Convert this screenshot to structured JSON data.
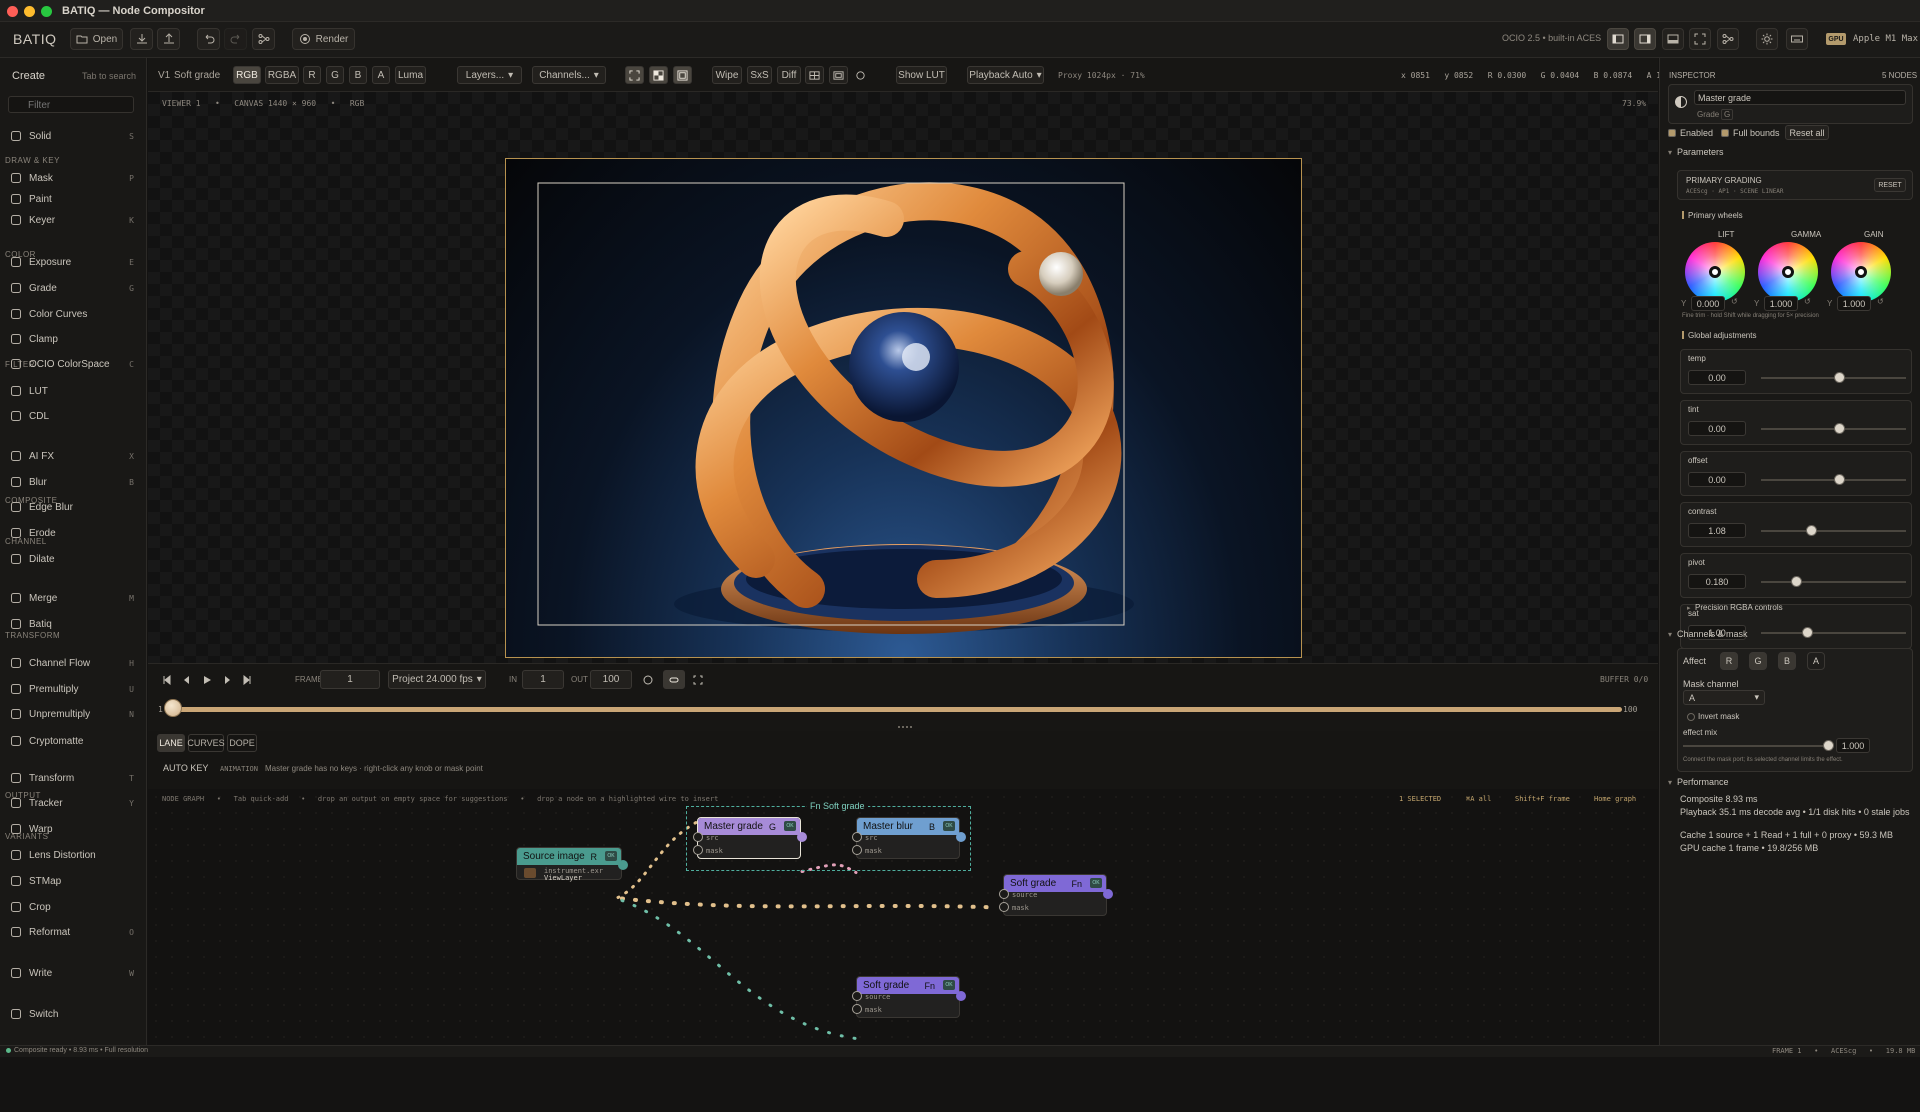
{
  "window": {
    "title": "BATIQ — Node Compositor"
  },
  "toolbar": {
    "logo": "BATIQ",
    "open": "Open",
    "render": "Render",
    "ocio": "OCIO 2.5 • built-in ACES",
    "gpu_badge": "GPU",
    "gpu_name": "Apple M1 Max"
  },
  "left": {
    "title": "Create",
    "hint": "Tab to search",
    "filter_placeholder": "Filter",
    "sections": {
      "draw": "DRAW & KEY",
      "color": "COLOR",
      "filter": "FILTER",
      "composite": "COMPOSITE",
      "channel": "CHANNEL",
      "transform": "TRANSFORM",
      "output": "OUTPUT",
      "variants": "VARIANTS"
    },
    "items": [
      {
        "label": "Solid",
        "key": "S",
        "icon": "solid-icon"
      },
      {
        "label": "Mask",
        "key": "P",
        "icon": "mask-icon"
      },
      {
        "label": "Paint",
        "key": "",
        "icon": "brush-icon"
      },
      {
        "label": "Keyer",
        "key": "K",
        "icon": "keyer-icon"
      },
      {
        "label": "Exposure",
        "key": "E",
        "icon": "exposure-icon"
      },
      {
        "label": "Grade",
        "key": "G",
        "icon": "grade-icon"
      },
      {
        "label": "Color Curves",
        "key": "",
        "icon": "curves-icon"
      },
      {
        "label": "Clamp",
        "key": "",
        "icon": "clamp-icon"
      },
      {
        "label": "OCIO ColorSpace",
        "key": "C",
        "icon": "colorspace-icon"
      },
      {
        "label": "LUT",
        "key": "",
        "icon": "lut-icon"
      },
      {
        "label": "CDL",
        "key": "",
        "icon": "cdl-icon"
      },
      {
        "label": "AI FX",
        "key": "X",
        "icon": "sparkle-icon"
      },
      {
        "label": "Blur",
        "key": "B",
        "icon": "blur-icon"
      },
      {
        "label": "Edge Blur",
        "key": "",
        "icon": "edge-blur-icon"
      },
      {
        "label": "Erode",
        "key": "",
        "icon": "erode-icon"
      },
      {
        "label": "Dilate",
        "key": "",
        "icon": "dilate-icon"
      },
      {
        "label": "Merge",
        "key": "M",
        "icon": "merge-icon"
      },
      {
        "label": "Batiq",
        "key": "",
        "icon": "batiq-icon"
      },
      {
        "label": "Channel Flow",
        "key": "H",
        "icon": "channel-flow-icon"
      },
      {
        "label": "Premultiply",
        "key": "U",
        "icon": "premultiply-icon"
      },
      {
        "label": "Unpremultiply",
        "key": "N",
        "icon": "unpremultiply-icon"
      },
      {
        "label": "Cryptomatte",
        "key": "",
        "icon": "cryptomatte-icon"
      },
      {
        "label": "Transform",
        "key": "T",
        "icon": "transform-icon"
      },
      {
        "label": "Tracker",
        "key": "Y",
        "icon": "tracker-icon"
      },
      {
        "label": "Warp",
        "key": "",
        "icon": "warp-icon"
      },
      {
        "label": "Lens Distortion",
        "key": "",
        "icon": "lens-icon"
      },
      {
        "label": "STMap",
        "key": "",
        "icon": "stmap-icon"
      },
      {
        "label": "Crop",
        "key": "",
        "icon": "crop-icon"
      },
      {
        "label": "Reformat",
        "key": "O",
        "icon": "reformat-icon"
      },
      {
        "label": "Write",
        "key": "W",
        "icon": "write-icon"
      },
      {
        "label": "Switch",
        "key": "",
        "icon": "switch-icon"
      }
    ]
  },
  "viewer": {
    "slot": "V1",
    "node": "Soft grade",
    "channels": [
      "RGB",
      "RGBA",
      "R",
      "G",
      "B",
      "A",
      "Luma"
    ],
    "layers": "Layers...",
    "channels_dd": "Channels...",
    "wipe": "Wipe",
    "sxs": "SxS",
    "diff": "Diff",
    "show_lut": "Show LUT",
    "playback": "Playback Auto",
    "proxy": "Proxy 1024px · 71%",
    "pixel_readout": "x 0851   y 0852   R 0.0300   G 0.0404   B 0.0874   A 1.0000",
    "info": "VIEWER 1   •   CANVAS 1440 × 960   •   RGB",
    "zoom": "73.9%"
  },
  "transport": {
    "frame_label": "FRAME",
    "frame": "1",
    "fps": "Project 24.000 fps",
    "in_label": "IN",
    "in": "1",
    "out_label": "OUT",
    "out": "100",
    "buffer": "BUFFER 0/0",
    "start": "1",
    "end": "100"
  },
  "timeline": {
    "tabs": [
      "LANE",
      "CURVES",
      "DOPE"
    ],
    "autokey": "AUTO KEY",
    "animation_label": "ANIMATION",
    "animation_msg": "Master grade has no keys · right-click any knob or mask point"
  },
  "graph": {
    "hint": "NODE GRAPH   •   Tab quick-add   •   drop an output on empty space for suggestions   •   drop a node on a highlighted wire to insert",
    "selected": "1 SELECTED",
    "all": "⌘A all",
    "frame": "Shift+F frame",
    "home": "Home graph",
    "group_label": "Fn Soft grade",
    "nodes": {
      "source": {
        "title": "Source image",
        "key": "R",
        "file": "instrument.exr",
        "layer": "ViewLayer",
        "color": "#4a9b8e"
      },
      "master_grade": {
        "title": "Master grade",
        "key": "G",
        "p1": "src",
        "p2": "mask",
        "color": "#a78bd8"
      },
      "master_blur": {
        "title": "Master blur",
        "key": "B",
        "p1": "src",
        "p2": "mask",
        "color": "#6f9fd0"
      },
      "soft_grade_1": {
        "title": "Soft grade",
        "key": "Fn",
        "p1": "source",
        "p2": "mask",
        "color": "#7f69d6"
      },
      "soft_grade_2": {
        "title": "Soft grade",
        "key": "Fn",
        "p1": "source",
        "p2": "mask",
        "color": "#7f69d6"
      }
    },
    "ok": "OK"
  },
  "inspector": {
    "title": "INSPECTOR",
    "count": "5 NODES",
    "node_name": "Master grade",
    "node_type": "Grade",
    "node_key": "G",
    "enabled": "Enabled",
    "full_bounds": "Full bounds",
    "reset_all": "Reset all",
    "parameters": "Parameters",
    "primary": {
      "title": "PRIMARY GRADING",
      "sub": "ACEScg · AP1 · SCENE LINEAR",
      "reset": "RESET"
    },
    "wheels_title": "Primary wheels",
    "wheels": [
      {
        "label": "LIFT",
        "y": "0.000"
      },
      {
        "label": "GAMMA",
        "y": "1.000"
      },
      {
        "label": "GAIN",
        "y": "1.000"
      }
    ],
    "fine": "Fine trim · hold Shift while dragging for 5× precision",
    "global_title": "Global adjustments",
    "params": [
      {
        "label": "temp",
        "value": "0.00",
        "level": 0.5
      },
      {
        "label": "tint",
        "value": "0.00",
        "level": 0.5
      },
      {
        "label": "offset",
        "value": "0.00",
        "level": 0.5
      },
      {
        "label": "contrast",
        "value": "1.08",
        "level": 0.31
      },
      {
        "label": "pivot",
        "value": "0.180",
        "level": 0.21
      },
      {
        "label": "sat",
        "value": "1.00",
        "level": 0.28
      }
    ],
    "precision": "Precision RGBA controls",
    "channels_mask": "Channels & mask",
    "affect": "Affect",
    "affect_btns": [
      "R",
      "G",
      "B",
      "A"
    ],
    "mask_channel": "Mask channel",
    "mask_value": "A",
    "invert": "Invert mask",
    "effect_mix": "effect mix",
    "mix_value": "1.000",
    "mix_note": "Connect the mask port; its selected channel limits the effect.",
    "performance": "Performance",
    "perf": [
      {
        "k": "Composite",
        "v": "8.93 ms"
      },
      {
        "k": "Playback",
        "v": "35.1 ms decode avg • 1/1 disk hits • 0 stale jobs"
      },
      {
        "k": "Cache",
        "v": "1 source + 1 Read + 1 full + 0 proxy • 59.3 MB"
      },
      {
        "k": "GPU cache",
        "v": "1 frame • 19.8/256 MB"
      }
    ]
  },
  "status": {
    "left": "Composite ready • 8.93 ms • Full resolution",
    "right": "FRAME 1   •   ACEScg   •   19.8 MB"
  },
  "colors": {
    "accent": "#caa676",
    "bg": "#141312"
  }
}
